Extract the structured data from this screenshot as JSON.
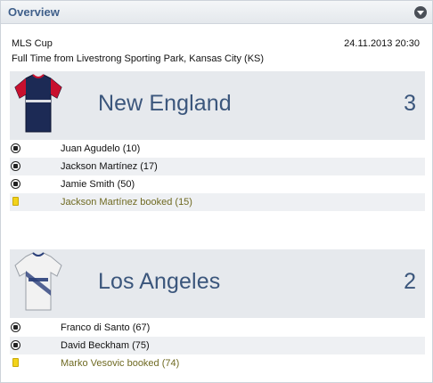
{
  "panel": {
    "title": "Overview"
  },
  "match": {
    "competition": "MLS Cup",
    "datetime": "24.11.2013 20:30",
    "venue": "Full Time from Livestrong Sporting Park, Kansas City (KS)"
  },
  "home": {
    "name": "New England",
    "score": "3",
    "kit_colors": {
      "body": "#1c2a55",
      "trim": "#c8102e"
    },
    "events": [
      {
        "type": "goal",
        "icon": "ball-icon",
        "text": "Juan Agudelo (10)"
      },
      {
        "type": "goal",
        "icon": "ball-icon",
        "text": "Jackson Martínez (17)"
      },
      {
        "type": "goal",
        "icon": "ball-icon",
        "text": "Jamie Smith (50)"
      },
      {
        "type": "booking",
        "icon": "yellow-card-icon",
        "text": "Jackson Martínez booked (15)"
      }
    ]
  },
  "away": {
    "name": "Los Angeles",
    "score": "2",
    "kit_colors": {
      "body": "#f2f2f2",
      "trim": "#2a3f7a"
    },
    "events": [
      {
        "type": "goal",
        "icon": "ball-icon",
        "text": "Franco di Santo (67)"
      },
      {
        "type": "goal",
        "icon": "ball-icon",
        "text": "David Beckham (75)"
      },
      {
        "type": "booking",
        "icon": "yellow-card-icon",
        "text": "Marko Vesovic booked (74)"
      }
    ]
  },
  "colors": {
    "accent": "#3b567c",
    "booking_text": "#6f6a22",
    "yellow_card": "#f2d31b"
  }
}
